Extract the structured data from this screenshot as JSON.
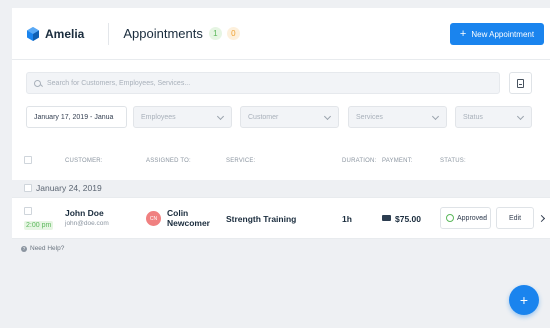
{
  "colors": {
    "accent": "#1a84ee",
    "success": "#5bb85b",
    "warning": "#f0a030",
    "avatar": "#f08080"
  },
  "header": {
    "logo_text": "Amelia",
    "title": "Appointments",
    "badge_approved": "1",
    "badge_pending": "0",
    "new_button_label": "New Appointment",
    "new_button_icon": "+"
  },
  "filters": {
    "search_placeholder": "Search for Customers, Employees, Services...",
    "date_range": "January 17, 2019 - Janua",
    "employees_placeholder": "Employees",
    "customer_placeholder": "Customer",
    "services_placeholder": "Services",
    "status_placeholder": "Status"
  },
  "table": {
    "headers": {
      "customer": "CUSTOMER:",
      "assigned_to": "ASSIGNED TO:",
      "service": "SERVICE:",
      "duration": "DURATION:",
      "payment": "PAYMENT:",
      "status": "STATUS:"
    },
    "date_group": "January 24, 2019",
    "rows": [
      {
        "time": "2:00 pm",
        "customer_name": "John Doe",
        "customer_email": "john@doe.com",
        "employee_initials": "CN",
        "employee_name": "Colin Newcomer",
        "service": "Strength Training",
        "duration": "1h",
        "payment": "$75.00",
        "status": "Approved",
        "edit_label": "Edit"
      }
    ]
  },
  "footer": {
    "help_icon": "?",
    "help_text": "Need Help?"
  },
  "fab_icon": "+"
}
